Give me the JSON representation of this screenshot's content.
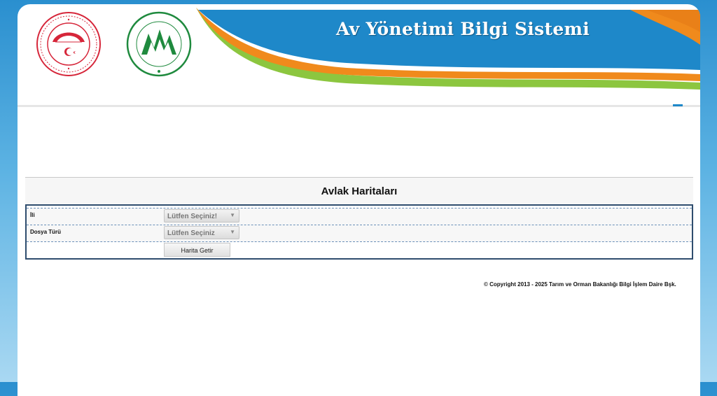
{
  "header": {
    "title": "Av Yönetimi Bilgi Sistemi",
    "logo_left_name": "Tarım ve Orman Bakanlığı seal",
    "logo_right_name": "Doğa Koruma ve Milli Parklar Genel Müdürlüğü logo"
  },
  "form": {
    "title": "Avlak Haritaları",
    "rows": [
      {
        "label": "İli",
        "value": "Lütfen Seçiniz!"
      },
      {
        "label": "Dosya Türü",
        "value": "Lütfen Seçiniz"
      }
    ],
    "submit_label": "Harita Getir"
  },
  "footer": {
    "copyright": "© Copyright 2013 - 2025  Tarım ve Orman Bakanlığı Bilgi İşlem Daire Bşk."
  },
  "colors": {
    "banner_blue": "#1e88c9",
    "banner_orange": "#f08a1c",
    "banner_green": "#8cc63f",
    "form_border": "#2f4d6e"
  },
  "icons": [
    "dropdown-caret-icon"
  ]
}
